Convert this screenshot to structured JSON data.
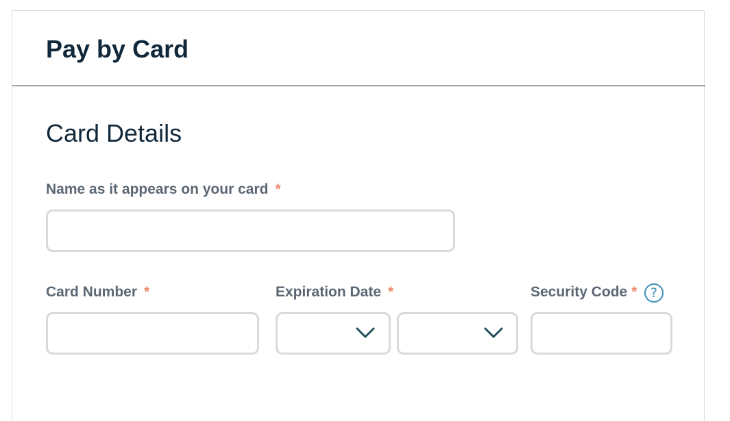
{
  "header": {
    "title": "Pay by Card"
  },
  "card_details": {
    "section_title": "Card Details",
    "required_marker": "*",
    "name_field": {
      "label": "Name as it appears on your card",
      "value": ""
    },
    "card_number_field": {
      "label": "Card Number",
      "value": ""
    },
    "expiration_date": {
      "label": "Expiration Date",
      "month_value": "",
      "year_value": ""
    },
    "security_code_field": {
      "label": "Security Code",
      "value": "",
      "help_icon_glyph": "?"
    }
  },
  "colors": {
    "heading": "#11283b",
    "label": "#5b6774",
    "required_asterisk": "#ee8a6c",
    "input_border": "#d7d9dc",
    "chevron": "#1f4f57",
    "help_icon": "#3b8fb9",
    "header_divider": "#14202b"
  },
  "icons": {
    "select_indicator": "chevron-down-icon",
    "help": "question-circle-icon"
  }
}
